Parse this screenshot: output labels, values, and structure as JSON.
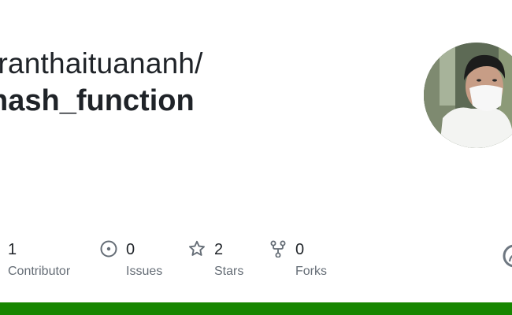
{
  "repo": {
    "owner": "tranthaituananh/",
    "name": "hash_function"
  },
  "stats": {
    "contributors": {
      "count": "1",
      "label": "Contributor"
    },
    "issues": {
      "count": "0",
      "label": "Issues"
    },
    "stars": {
      "count": "2",
      "label": "Stars"
    },
    "forks": {
      "count": "0",
      "label": "Forks"
    }
  },
  "language_bar": {
    "color": "#178600",
    "fraction": 1.0
  },
  "icons": [
    "issue-opened-icon",
    "star-icon",
    "repo-forked-icon",
    "github-mark-icon"
  ]
}
